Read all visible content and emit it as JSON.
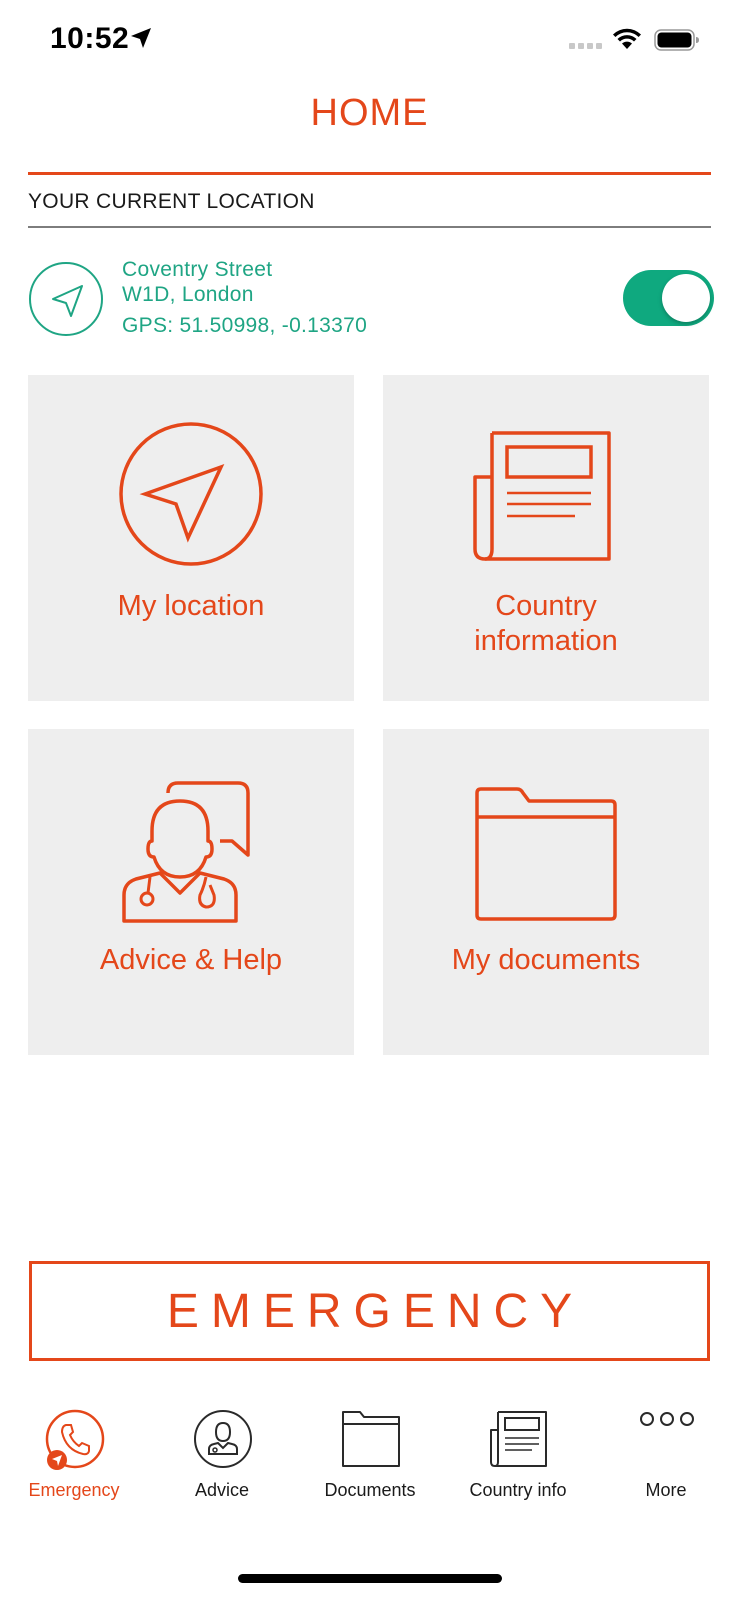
{
  "status_bar": {
    "time": "10:52"
  },
  "header": {
    "title": "HOME"
  },
  "location": {
    "section_label": "YOUR CURRENT LOCATION",
    "street": "Coventry Street",
    "city": "W1D, London",
    "gps": "GPS: 51.50998, -0.13370",
    "sharing_enabled": true
  },
  "tiles": [
    {
      "label_line1": "My location",
      "label_line2": "",
      "icon": "location-arrow-icon"
    },
    {
      "label_line1": "Country",
      "label_line2": "information",
      "icon": "newspaper-icon"
    },
    {
      "label_line1": "Advice & Help",
      "label_line2": "",
      "icon": "doctor-chat-icon"
    },
    {
      "label_line1": "My documents",
      "label_line2": "",
      "icon": "folder-icon"
    }
  ],
  "emergency_button": {
    "label": "EMERGENCY"
  },
  "tabbar": {
    "items": [
      {
        "label": "Emergency",
        "icon": "phone-icon",
        "active": true
      },
      {
        "label": "Advice",
        "icon": "doctor-icon",
        "active": false
      },
      {
        "label": "Documents",
        "icon": "folder-icon",
        "active": false
      },
      {
        "label": "Country info",
        "icon": "newspaper-icon",
        "active": false
      },
      {
        "label": "More",
        "icon": "more-icon",
        "active": false
      }
    ]
  },
  "colors": {
    "accent": "#e4471a",
    "green": "#1fa584",
    "toggle": "#0fa97f",
    "tile_bg": "#eeeeee"
  }
}
